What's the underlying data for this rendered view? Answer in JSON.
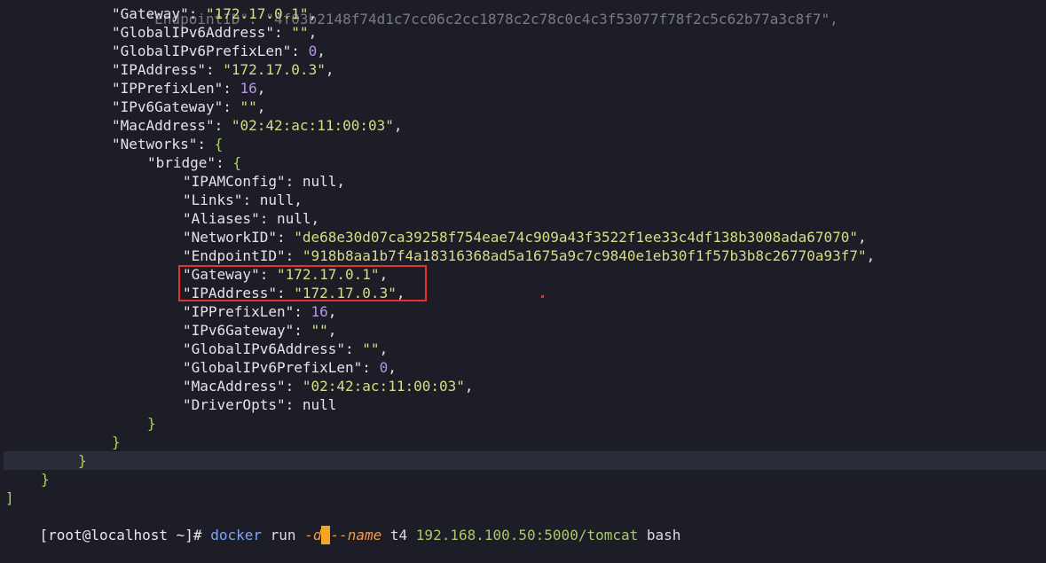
{
  "terminal": {
    "partial_top_line": "\"EndpointID\": \"4f03b2148f74d1c7cc06c2cc1878c2c78c0c4c3f53077f78f2c5c62b77a3c8f7\",",
    "top_fields": [
      {
        "key": "\"Gateway\"",
        "value": "\"172.17.0.1\"",
        "vtype": "s"
      },
      {
        "key": "\"GlobalIPv6Address\"",
        "value": "\"\"",
        "vtype": "s"
      },
      {
        "key": "\"GlobalIPv6PrefixLen\"",
        "value": "0",
        "vtype": "n"
      },
      {
        "key": "\"IPAddress\"",
        "value": "\"172.17.0.3\"",
        "vtype": "s"
      },
      {
        "key": "\"IPPrefixLen\"",
        "value": "16",
        "vtype": "n"
      },
      {
        "key": "\"IPv6Gateway\"",
        "value": "\"\"",
        "vtype": "s"
      },
      {
        "key": "\"MacAddress\"",
        "value": "\"02:42:ac:11:00:03\"",
        "vtype": "s"
      }
    ],
    "networks_key": "\"Networks\"",
    "bridge_key": "\"bridge\"",
    "bridge_fields": [
      {
        "key": "\"IPAMConfig\"",
        "value": "null",
        "vtype": "lit"
      },
      {
        "key": "\"Links\"",
        "value": "null",
        "vtype": "lit"
      },
      {
        "key": "\"Aliases\"",
        "value": "null",
        "vtype": "lit"
      },
      {
        "key": "\"NetworkID\"",
        "value": "\"de68e30d07ca39258f754eae74c909a43f3522f1ee33c4df138b3008ada67070\"",
        "vtype": "s"
      },
      {
        "key": "\"EndpointID\"",
        "value": "\"918b8aa1b7f4a18316368ad5a1675a9c7c9840e1eb30f1f57b3b8c26770a93f7\"",
        "vtype": "s"
      },
      {
        "key": "\"Gateway\"",
        "value": "\"172.17.0.1\"",
        "vtype": "s"
      },
      {
        "key": "\"IPAddress\"",
        "value": "\"172.17.0.3\"",
        "vtype": "s"
      },
      {
        "key": "\"IPPrefixLen\"",
        "value": "16",
        "vtype": "n"
      },
      {
        "key": "\"IPv6Gateway\"",
        "value": "\"\"",
        "vtype": "s"
      },
      {
        "key": "\"GlobalIPv6Address\"",
        "value": "\"\"",
        "vtype": "s"
      },
      {
        "key": "\"GlobalIPv6PrefixLen\"",
        "value": "0",
        "vtype": "n"
      },
      {
        "key": "\"MacAddress\"",
        "value": "\"02:42:ac:11:00:03\"",
        "vtype": "s"
      },
      {
        "key": "\"DriverOpts\"",
        "value": "null",
        "vtype": "lit"
      }
    ],
    "closing": [
      "}",
      "}",
      "}",
      "}",
      "]"
    ],
    "prompt": {
      "user_host": "[root@localhost ~]",
      "symbol": "#",
      "command": "docker",
      "subcommand": "run",
      "flag_d": "-d",
      "flag_name": "--name",
      "name_value": "t4",
      "image": "192.168.100.50:5000/tomcat",
      "shell": "bash"
    }
  },
  "colors": {
    "background": "#1c1d26",
    "string": "#d8dc86",
    "number": "#b993e8",
    "highlight_box": "#e2332f",
    "cursor": "#f5a623"
  }
}
